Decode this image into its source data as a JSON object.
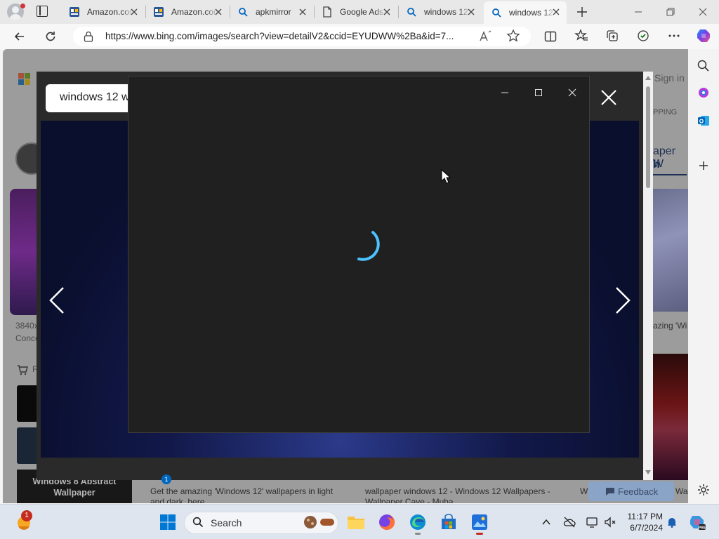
{
  "browser": {
    "tabs": [
      {
        "title": "Amazon.com",
        "icon": "msn-news-icon",
        "active": false
      },
      {
        "title": "Amazon.com",
        "icon": "msn-news-icon",
        "active": false
      },
      {
        "title": "apkmirror",
        "icon": "search-icon",
        "active": false
      },
      {
        "title": "Google Ads",
        "icon": "document-icon",
        "active": false
      },
      {
        "title": "windows 12",
        "icon": "search-icon",
        "active": false
      },
      {
        "title": "windows 12",
        "icon": "search-icon",
        "active": true
      }
    ],
    "url": "https://www.bing.com/images/search?view=detailV2&ccid=EYUDWW%2Ba&id=7..."
  },
  "bing_page": {
    "sign_in": "Sign in",
    "search_query": "windows 12 w",
    "shopping_tab": "PPING",
    "right_partial_text": "aper W",
    "right_partial_text2": "h",
    "left_caption_line1": "3840x",
    "left_caption_line2": "Conce",
    "left_section_initial": "F",
    "right_caption": "azing 'Wi",
    "tile_label": "Windows 8 Abstract Wallpaper",
    "result1_caption": "Get the amazing 'Windows 12' wallpapers in light and dark, here",
    "result2_caption": "wallpaper windows 12 - Windows 12 Wallpapers - Wallpaper Cave - Muha",
    "result3_initial": "W",
    "result4_initial": "Wa",
    "feedback": "Feedback",
    "badge_count": "1"
  },
  "loading_window": {
    "state": "loading"
  },
  "taskbar": {
    "search_placeholder": "Search",
    "notification_count": "1",
    "time": "11:17 PM",
    "date": "6/7/2024"
  },
  "colors": {
    "spinner": "#4cc2ff",
    "accent": "#0067c0",
    "dialog_bg": "#202020",
    "viewer_bg": "#2a2a2a"
  }
}
